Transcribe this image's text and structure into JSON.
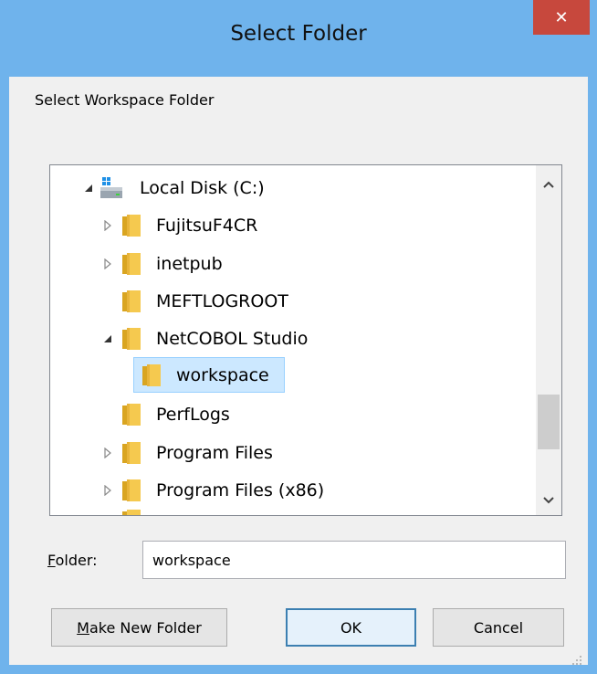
{
  "window": {
    "title": "Select Folder",
    "close_glyph": "✕",
    "frame_color": "#6fb3ec",
    "close_color": "#c7483d"
  },
  "dialog": {
    "prompt": "Select Workspace Folder"
  },
  "tree": {
    "items": [
      {
        "label": "Local Disk (C:)",
        "icon": "drive-icon",
        "expander": "expanded"
      },
      {
        "label": "FujitsuF4CR",
        "icon": "folder-icon",
        "expander": "collapsed"
      },
      {
        "label": "inetpub",
        "icon": "folder-icon",
        "expander": "collapsed"
      },
      {
        "label": "MEFTLOGROOT",
        "icon": "folder-icon",
        "expander": "none"
      },
      {
        "label": "NetCOBOL Studio",
        "icon": "folder-icon",
        "expander": "expanded"
      },
      {
        "label": "workspace",
        "icon": "folder-icon",
        "expander": "none",
        "selected": true
      },
      {
        "label": "PerfLogs",
        "icon": "folder-icon",
        "expander": "none"
      },
      {
        "label": "Program Files",
        "icon": "folder-icon",
        "expander": "collapsed"
      },
      {
        "label": "Program Files (x86)",
        "icon": "folder-icon",
        "expander": "collapsed"
      }
    ],
    "scroll_position": 0.7
  },
  "folder_field": {
    "label_underlined": "F",
    "label_rest": "older:",
    "value": "workspace"
  },
  "buttons": {
    "make_new_folder_underlined": "M",
    "make_new_folder_rest": "ake New Folder",
    "ok": "OK",
    "cancel": "Cancel"
  },
  "colors": {
    "selection_bg": "#cce8ff",
    "selection_border": "#99d1ff",
    "folder_yellow": "#f5c94f"
  }
}
